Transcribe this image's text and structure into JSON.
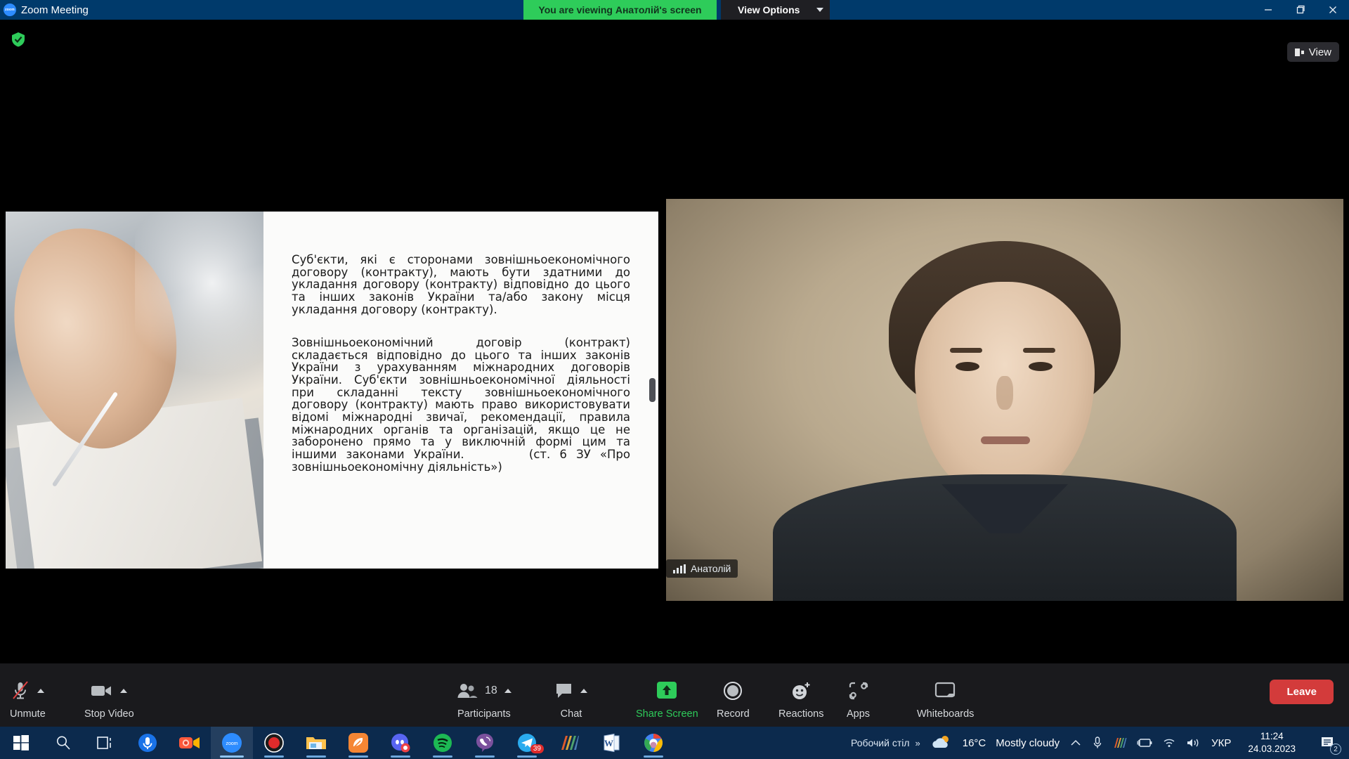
{
  "titlebar": {
    "app_title": "Zoom Meeting",
    "logo_text": "zoom",
    "viewing_banner": "You are viewing Анатолій's screen",
    "view_options_label": "View Options",
    "minimize_icon": "minimize-icon",
    "maximize_icon": "maximize-icon",
    "close_icon": "close-icon"
  },
  "stage": {
    "encryption_icon": "shield-check-icon",
    "view_toggle_label": "View",
    "view_toggle_icon": "layout-icon"
  },
  "shared_screen": {
    "slide": {
      "photo_alt": "hand-writing-photo",
      "paragraph_1": "Суб'єкти, які є сторонами зовнішньоекономічного договору (контракту), мають бути здатними до укладання договору (контракту) відповідно до цього та інших законів України та/або закону місця укладання договору (контракту).",
      "paragraph_2": "Зовнішньоекономічний договір (контракт) складається відповідно до цього та інших законів України з урахуванням міжнародних договорів України. Суб'єкти зовнішньоекономічної діяльності при складанні тексту зовнішньоекономічного договору (контракту) мають право використовувати відомі міжнародні звичаї, рекомендації, правила міжнародних органів та організацій, якщо це не заборонено прямо та у виключній формі цим та іншими законами України.       (ст. 6 ЗУ «Про зовнішньоекономічну діяльність»)"
    },
    "drag_handle_icon": "drag-handle-icon"
  },
  "speaker": {
    "name": "Анатолій",
    "audio_icon": "audio-bars-icon"
  },
  "toolbar": {
    "items": [
      {
        "id": "audio",
        "label": "Unmute",
        "icon": "microphone-muted-icon",
        "has_caret": true,
        "count": null,
        "highlight": false
      },
      {
        "id": "video",
        "label": "Stop Video",
        "icon": "camera-icon",
        "has_caret": true,
        "count": null,
        "highlight": false
      },
      {
        "id": "participants",
        "label": "Participants",
        "icon": "people-icon",
        "has_caret": true,
        "count": "18",
        "highlight": false
      },
      {
        "id": "chat",
        "label": "Chat",
        "icon": "chat-bubble-icon",
        "has_caret": true,
        "count": null,
        "highlight": false
      },
      {
        "id": "share",
        "label": "Share Screen",
        "icon": "share-screen-icon",
        "has_caret": false,
        "count": null,
        "highlight": true
      },
      {
        "id": "record",
        "label": "Record",
        "icon": "record-circle-icon",
        "has_caret": false,
        "count": null,
        "highlight": false
      },
      {
        "id": "reactions",
        "label": "Reactions",
        "icon": "smiley-plus-icon",
        "has_caret": false,
        "count": null,
        "highlight": false
      },
      {
        "id": "apps",
        "label": "Apps",
        "icon": "apps-icon",
        "has_caret": false,
        "count": null,
        "highlight": false
      },
      {
        "id": "whiteboards",
        "label": "Whiteboards",
        "icon": "whiteboard-icon",
        "has_caret": false,
        "count": null,
        "highlight": false
      }
    ],
    "leave_label": "Leave",
    "accent_green": "#2ecc5a",
    "leave_red": "#d33b3b"
  },
  "taskbar": {
    "start_icon": "windows-start-icon",
    "search_icon": "search-icon",
    "taskview_icon": "task-view-icon",
    "apps": [
      {
        "id": "voice-recorder",
        "icon": "microphone-app-icon",
        "badge": null,
        "running": false,
        "active": false
      },
      {
        "id": "screen-recorder",
        "icon": "camera-record-icon",
        "badge": null,
        "running": false,
        "active": false
      },
      {
        "id": "zoom",
        "icon": "zoom-app-icon",
        "badge": null,
        "running": true,
        "active": true
      },
      {
        "id": "obs-record",
        "icon": "record-dot-icon",
        "badge": null,
        "running": true,
        "active": false
      },
      {
        "id": "explorer",
        "icon": "file-explorer-icon",
        "badge": null,
        "running": true,
        "active": false
      },
      {
        "id": "orange-app",
        "icon": "orange-leaf-icon",
        "badge": null,
        "running": true,
        "active": false
      },
      {
        "id": "discord",
        "icon": "discord-icon",
        "badge": null,
        "running": true,
        "active": false
      },
      {
        "id": "spotify",
        "icon": "spotify-icon",
        "badge": null,
        "running": true,
        "active": false
      },
      {
        "id": "viber",
        "icon": "viber-icon",
        "badge": null,
        "running": true,
        "active": false
      },
      {
        "id": "telegram",
        "icon": "telegram-icon",
        "badge": "39",
        "running": true,
        "active": false
      },
      {
        "id": "stripes-app",
        "icon": "color-stripes-icon",
        "badge": null,
        "running": false,
        "active": false
      },
      {
        "id": "word",
        "icon": "word-icon",
        "badge": null,
        "running": false,
        "active": false
      },
      {
        "id": "chrome",
        "icon": "chrome-icon",
        "badge": null,
        "running": true,
        "active": false
      }
    ],
    "desktop_label": "Робочий стіл",
    "overflow_icon": "chevron-double-right-icon",
    "weather_icon": "partly-cloudy-icon",
    "weather_temp": "16°C",
    "weather_desc": "Mostly cloudy",
    "tray_chevron_icon": "chevron-up-icon",
    "tray_mic_icon": "microphone-tray-icon",
    "tray_stripes_icon": "color-stripes-tray-icon",
    "tray_battery_icon": "battery-charging-icon",
    "tray_wifi_icon": "wifi-icon",
    "tray_volume_icon": "volume-icon",
    "language": "УКР",
    "clock_time": "11:24",
    "clock_date": "24.03.2023",
    "notification_icon": "notification-icon",
    "notification_count": "2"
  }
}
